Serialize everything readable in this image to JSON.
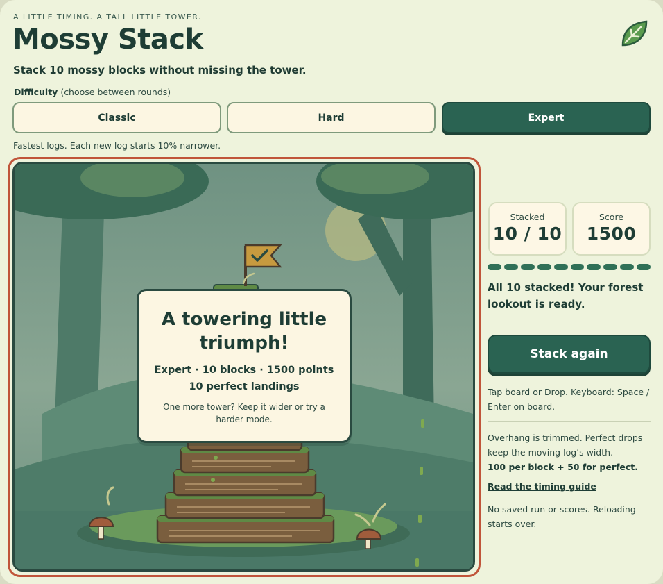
{
  "header": {
    "eyebrow": "A LITTLE TIMING. A TALL LITTLE TOWER.",
    "title": "Mossy Stack",
    "subtitle": "Stack 10 mossy blocks without missing the tower.",
    "logo_icon": "leaf-icon"
  },
  "difficulty": {
    "label": "Difficulty",
    "note": "(choose between rounds)",
    "options": [
      "Classic",
      "Hard",
      "Expert"
    ],
    "selected": "Expert",
    "hint": "Fastest logs. Each new log starts 10% narrower."
  },
  "result": {
    "title": "A towering little triumph!",
    "summary": "Expert · 10 blocks · 1500 points",
    "perfect": "10 perfect landings",
    "tip": "One more tower? Keep it wider or try a harder mode."
  },
  "stats": {
    "stacked_label": "Stacked",
    "stacked_value": "10 / 10",
    "score_label": "Score",
    "score_value": "1500"
  },
  "progress": {
    "filled": 10,
    "total": 10
  },
  "status": "All 10 stacked! Your forest lookout is ready.",
  "actions": {
    "again_label": "Stack again"
  },
  "help": "Tap board or Drop. Keyboard: Space / Enter on board.",
  "rules": {
    "text": "Overhang is trimmed. Perfect drops keep the moving log’s width.",
    "scoring": "100 per block + 50 for perfect."
  },
  "guide_link": "Read the timing guide",
  "save_note": "No saved run or scores. Reloading starts over.",
  "colors": {
    "accent": "#2a6352",
    "frame": "#c0553a",
    "background": "#eef3dc",
    "card": "#fcf6e2"
  }
}
